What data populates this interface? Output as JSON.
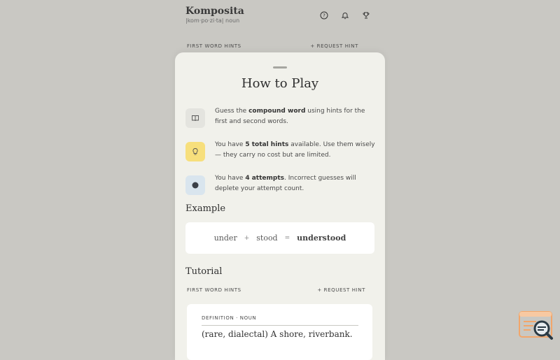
{
  "app": {
    "title": "Komposita",
    "pronunciation": "|kom·po·zi·ta| noun",
    "header_icons": [
      "help-icon",
      "bell-icon",
      "trophy-icon"
    ]
  },
  "background_hints": {
    "label": "FIRST WORD HINTS",
    "request_label": "+ REQUEST HINT"
  },
  "modal": {
    "title": "How to Play",
    "rules": [
      {
        "icon": "book-icon",
        "color": "#e4e4df",
        "pre": "Guess the ",
        "bold": "compound word",
        "post": " using hints for the first and second words."
      },
      {
        "icon": "lightbulb-icon",
        "color": "#f7df7c",
        "pre": "You have ",
        "bold": "5 total hints",
        "post": " available. Use them wisely — they carry no cost but are limited."
      },
      {
        "icon": "dot-icon",
        "color": "#d9e5ee",
        "pre": "You have ",
        "bold": "4 attempts",
        "post": ". Incorrect guesses will deplete your attempt count."
      }
    ],
    "example": {
      "heading": "Example",
      "first": "under",
      "plus": "+",
      "second": "stood",
      "equals": "=",
      "result": "understood"
    },
    "tutorial": {
      "heading": "Tutorial",
      "hints_label": "FIRST WORD HINTS",
      "request_label": "+ REQUEST HINT",
      "definition_label": "DEFINITION · NOUN",
      "definition_text": "(rare, dialectal) A shore, riverbank."
    }
  },
  "colors": {
    "background": "#c9c8c3",
    "sheet": "#f1f1eb",
    "accent_yellow": "#f7df7c",
    "accent_blue": "#d9e5ee"
  }
}
